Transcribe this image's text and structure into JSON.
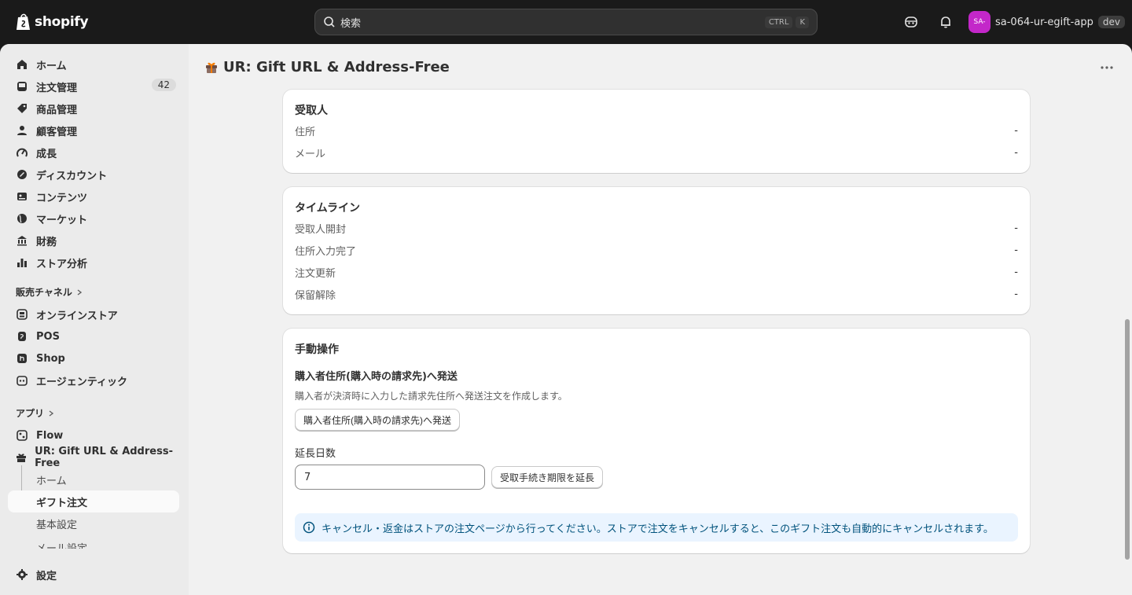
{
  "topbar": {
    "brand": "shopify",
    "search_placeholder": "検索",
    "shortcut_mod": "CTRL",
    "shortcut_key": "K",
    "store_avatar": "SA-",
    "store_name": "sa-064-ur-egift-app",
    "env_badge": "dev"
  },
  "sidebar": {
    "items": [
      {
        "label": "ホーム",
        "icon": "home-icon"
      },
      {
        "label": "注文管理",
        "icon": "inbox-icon",
        "count": "42"
      },
      {
        "label": "商品管理",
        "icon": "tag-icon"
      },
      {
        "label": "顧客管理",
        "icon": "person-icon"
      },
      {
        "label": "成長",
        "icon": "gauge-icon"
      },
      {
        "label": "ディスカウント",
        "icon": "discount-icon"
      },
      {
        "label": "コンテンツ",
        "icon": "content-icon"
      },
      {
        "label": "マーケット",
        "icon": "globe-icon"
      },
      {
        "label": "財務",
        "icon": "bank-icon"
      },
      {
        "label": "ストア分析",
        "icon": "bar-chart-icon"
      }
    ],
    "sales_channels_label": "販売チャネル",
    "channels": [
      {
        "label": "オンラインストア",
        "icon": "store-icon"
      },
      {
        "label": "POS",
        "icon": "pos-icon"
      },
      {
        "label": "Shop",
        "icon": "shop-icon"
      },
      {
        "label": "エージェンティック",
        "icon": "agentic-icon"
      }
    ],
    "apps_label": "アプリ",
    "apps": [
      {
        "label": "Flow",
        "icon": "flow-icon"
      },
      {
        "label": "UR: Gift URL & Address-Free",
        "icon": "gift-icon"
      }
    ],
    "app_sub": [
      "ホーム",
      "ギフト注文",
      "基本設定",
      "メール設定"
    ],
    "settings_label": "設定"
  },
  "header": {
    "title": "UR: Gift URL & Address-Free"
  },
  "recipient": {
    "heading": "受取人",
    "rows": [
      {
        "label": "住所",
        "value": "-"
      },
      {
        "label": "メール",
        "value": "-"
      }
    ]
  },
  "timeline": {
    "heading": "タイムライン",
    "rows": [
      {
        "label": "受取人開封",
        "value": "-"
      },
      {
        "label": "住所入力完了",
        "value": "-"
      },
      {
        "label": "注文更新",
        "value": "-"
      },
      {
        "label": "保留解除",
        "value": "-"
      }
    ]
  },
  "manual": {
    "heading": "手動操作",
    "ship_heading": "購入者住所(購入時の請求先)へ発送",
    "ship_desc": "購入者が決済時に入力した請求先住所へ発送注文を作成します。",
    "ship_button": "購入者住所(購入時の請求先)へ発送",
    "extend_label": "延長日数",
    "extend_value": "7",
    "extend_button": "受取手続き期限を延長",
    "banner": "キャンセル・返金はストアの注文ページから行ってください。ストアで注文をキャンセルすると、このギフト注文も自動的にキャンセルされます。"
  },
  "colors": {
    "topbar": "#1a1a1a",
    "avatar": "#c327c9",
    "banner_bg": "#eaf4ff",
    "banner_text": "#00527c"
  }
}
